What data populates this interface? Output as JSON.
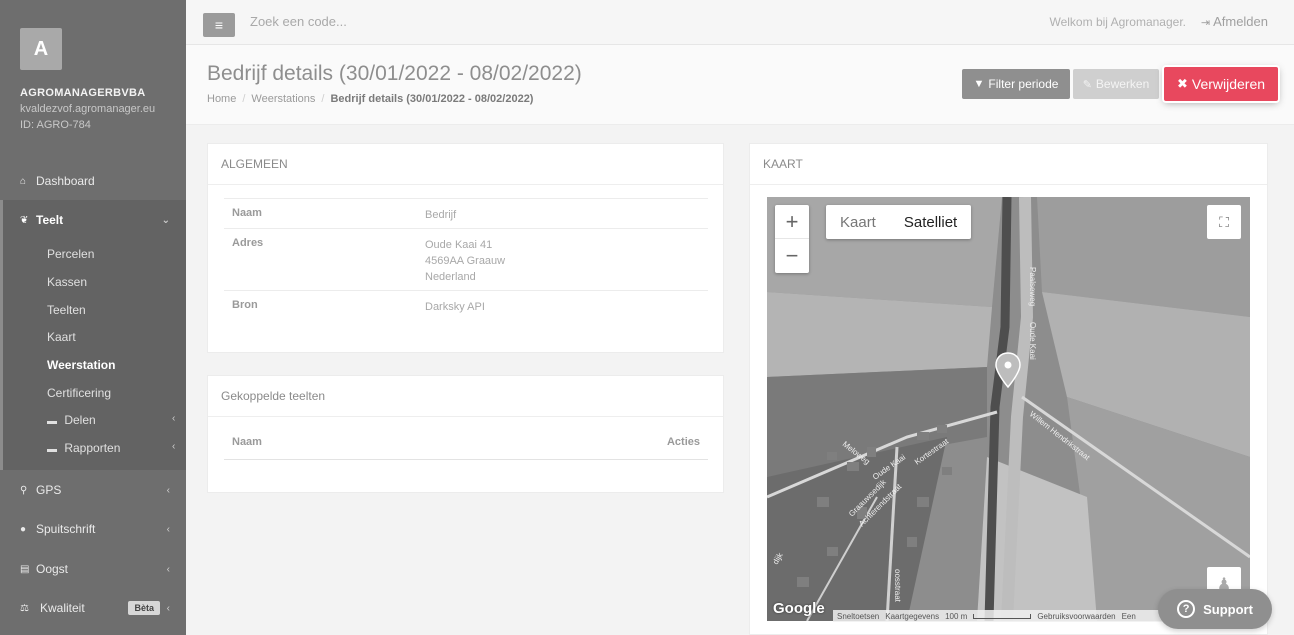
{
  "sidebar": {
    "logo_letter": "A",
    "company": "AGROMANAGERBVBA",
    "email": "kvaldezvof.agromanager.eu",
    "id": "ID: AGRO-784",
    "items": {
      "dashboard": "Dashboard",
      "teelt": "Teelt",
      "gps": "GPS",
      "spuitschrift": "Spuitschrift",
      "oogst": "Oogst",
      "kwaliteit": "Kwaliteit"
    },
    "teelt_sub": {
      "percelen": "Percelen",
      "kassen": "Kassen",
      "teelten": "Teelten",
      "kaart": "Kaart",
      "weerstation": "Weerstation",
      "certificering": "Certificering",
      "delen": "Delen",
      "rapporten": "Rapporten"
    },
    "beta_badge": "Bèta"
  },
  "topbar": {
    "search_placeholder": "Zoek een code...",
    "welcome": "Welkom bij Agromanager.",
    "logout": "Afmelden"
  },
  "header": {
    "title": "Bedrijf details (30/01/2022 - 08/02/2022)",
    "breadcrumb": {
      "home": "Home",
      "weerstations": "Weerstations",
      "current": "Bedrijf details (30/01/2022 - 08/02/2022)"
    },
    "buttons": {
      "filter": "Filter periode",
      "edit": "Bewerken",
      "delete": "Verwijderen"
    }
  },
  "algemeen": {
    "title": "ALGEMEEN",
    "naam_label": "Naam",
    "naam_value": "Bedrijf",
    "adres_label": "Adres",
    "adres_line1": "Oude Kaai 41",
    "adres_line2": "4569AA Graauw",
    "adres_line3": "Nederland",
    "bron_label": "Bron",
    "bron_value": "Darksky API"
  },
  "gekoppelde": {
    "title": "Gekoppelde teelten",
    "col_naam": "Naam",
    "col_acties": "Acties"
  },
  "kaart": {
    "title": "KAART",
    "type_map": "Kaart",
    "type_satellite": "Satelliet",
    "google": "Google",
    "attribution": {
      "shortcuts": "Sneltoetsen",
      "data": "Kaartgegevens",
      "scale": "100 m",
      "terms": "Gebruiksvoorwaarden",
      "report": "Een"
    },
    "roads": {
      "paalseweg": "Paalseweg",
      "oude_kaai": "Oude Kaai",
      "willem": "Willem Hendrikstraat",
      "meloweg": "Meloweg",
      "oude_kaai2": "Oude Kaai",
      "kortestraat": "Kortestraat",
      "graauwsedijk": "Graauwsedijk",
      "achterendstraat": "Achterendstraat",
      "dijk": "dijk",
      "oosstraat": "oosstraat"
    }
  },
  "support": "Support"
}
